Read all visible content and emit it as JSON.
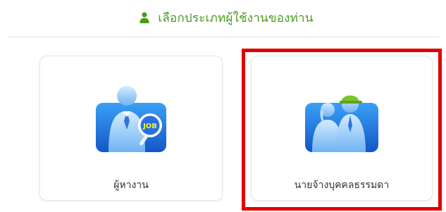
{
  "header": {
    "icon": "user-icon",
    "title": "เลือกประเภทผู้ใช้งานของท่าน"
  },
  "cards": [
    {
      "id": "job-seeker",
      "icon": "job-seeker-search-icon",
      "badge": "JOB",
      "label": "ผู้หางาน"
    },
    {
      "id": "individual-employer",
      "icon": "employer-people-icon",
      "label": "นายจ้างบุคคลธรรมดา",
      "highlighted": true
    }
  ],
  "colors": {
    "accent_green": "#4a9a1f",
    "icon_blue": "#1e66d8",
    "highlight_red": "#e10000"
  }
}
